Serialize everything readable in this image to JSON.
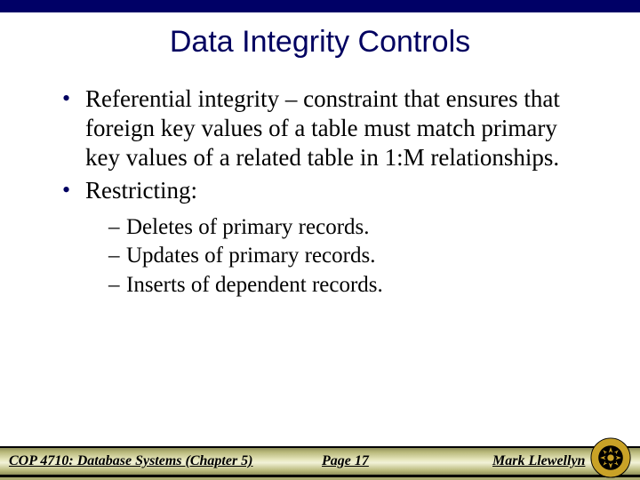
{
  "title": "Data Integrity Controls",
  "bullets": {
    "item1": "Referential integrity – constraint that ensures that foreign key values of a table must match primary key values of a related table in 1:M relationships.",
    "item2": "Restricting:",
    "sub1": "Deletes of primary records.",
    "sub2": "Updates of primary records.",
    "sub3": "Inserts of dependent records."
  },
  "footer": {
    "course": "COP 4710: Database Systems  (Chapter 5)",
    "page": "Page 17",
    "author": "Mark Llewellyn"
  }
}
